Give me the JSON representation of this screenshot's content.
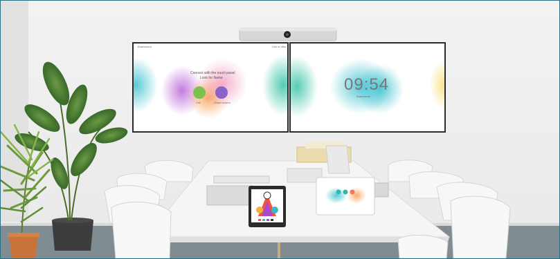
{
  "scene": "meeting-room-video-conference",
  "left_screen": {
    "room_name": "Boardroom",
    "top_right": "Link to Mac",
    "prompt_line1": "Connect with the touch panel",
    "prompt_line2": "Look for Name",
    "buttons": [
      {
        "label": "Call",
        "color": "#7cc24d"
      },
      {
        "label": "Share screen",
        "color": "#8a63c9"
      }
    ]
  },
  "right_screen": {
    "clock": "09:54",
    "room_name": "Boardroom"
  },
  "touch_panel_icon": "room-navigator-icon",
  "colors": {
    "wall": "#eeeeee",
    "floor": "#7f8d93",
    "table": "#f4f4f4",
    "bezel": "#2b2b2b",
    "accent_cyan": "#58c7d4",
    "accent_purple": "#b36bd8",
    "accent_orange": "#f4a25b"
  }
}
